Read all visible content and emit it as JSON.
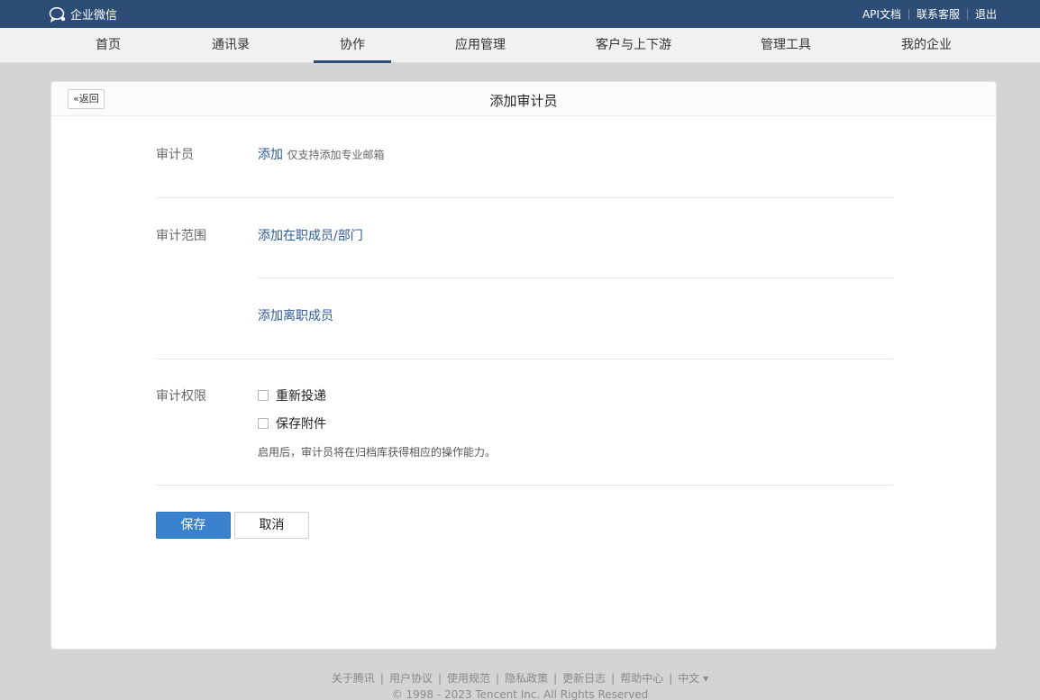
{
  "topbar": {
    "logo_text": "企业微信",
    "links": [
      "API文档",
      "联系客服",
      "退出"
    ]
  },
  "nav": {
    "items": [
      "首页",
      "通讯录",
      "协作",
      "应用管理",
      "客户与上下游",
      "管理工具",
      "我的企业"
    ],
    "active": "协作"
  },
  "panel": {
    "back_label": "«返回",
    "title": "添加审计员"
  },
  "form": {
    "auditor": {
      "label": "审计员",
      "add_link": "添加",
      "hint": "仅支持添加专业邮箱"
    },
    "scope": {
      "label": "审计范围",
      "add_current": "添加在职成员/部门",
      "add_former": "添加离职成员"
    },
    "permission": {
      "label": "审计权限",
      "options": [
        {
          "label": "重新投递",
          "checked": false
        },
        {
          "label": "保存附件",
          "checked": false
        }
      ],
      "note": "启用后，审计员将在归档库获得相应的操作能力。"
    },
    "save_label": "保存",
    "cancel_label": "取消"
  },
  "footer": {
    "links": [
      "关于腾讯",
      "用户协议",
      "使用规范",
      "隐私政策",
      "更新日志",
      "帮助中心",
      "中文 ▾"
    ],
    "copyright": "© 1998 - 2023 Tencent Inc. All Rights Reserved"
  },
  "colors": {
    "topbar": "#2e4d76",
    "link": "#2b5a96",
    "primary_button": "#3a82cd"
  }
}
